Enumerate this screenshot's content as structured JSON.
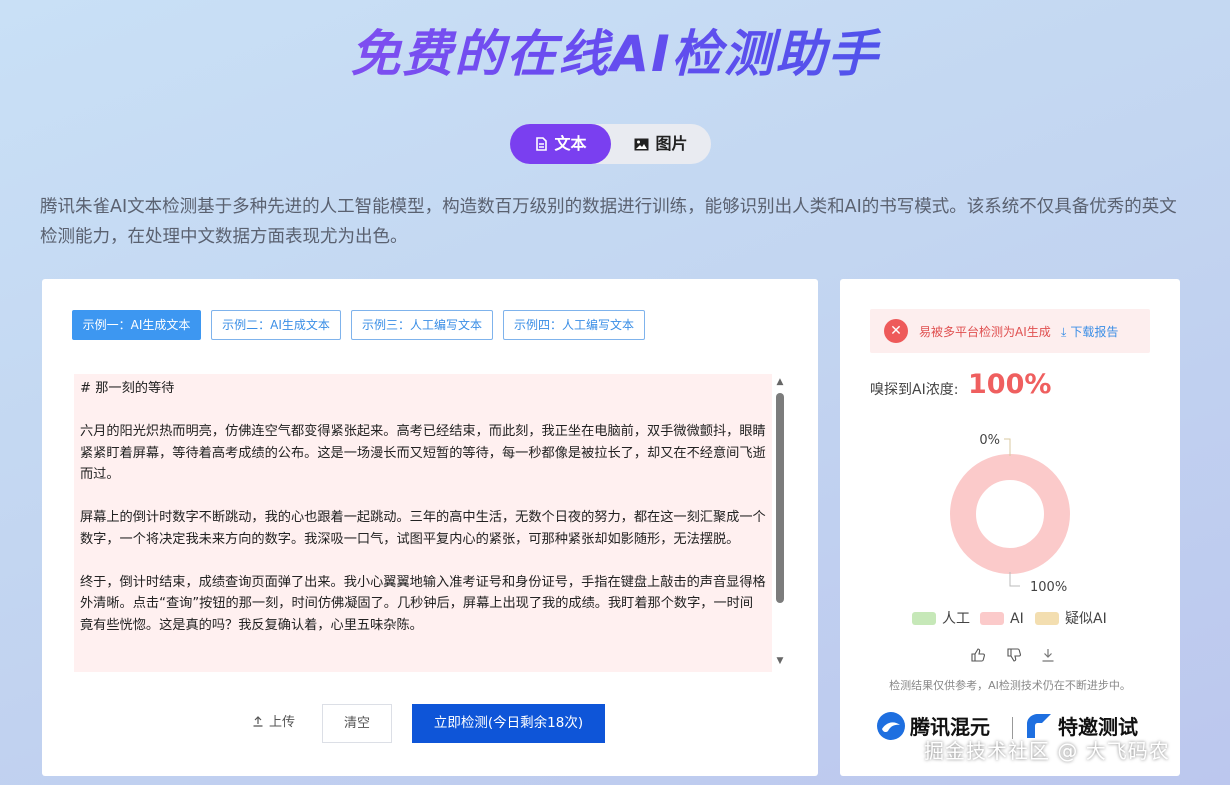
{
  "title": "免费的在线AI检测助手",
  "tabs": [
    {
      "label": "文本",
      "icon": "document-icon",
      "active": true
    },
    {
      "label": "图片",
      "icon": "image-icon",
      "active": false
    }
  ],
  "description": "腾讯朱雀AI文本检测基于多种先进的人工智能模型，构造数百万级别的数据进行训练，能够识别出人类和AI的书写模式。该系统不仅具备优秀的英文检测能力，在处理中文数据方面表现尤为出色。",
  "samples": [
    {
      "label": "示例一：AI生成文本",
      "active": true
    },
    {
      "label": "示例二：AI生成文本",
      "active": false
    },
    {
      "label": "示例三：人工编写文本",
      "active": false
    },
    {
      "label": "示例四：人工编写文本",
      "active": false
    }
  ],
  "editor": {
    "paragraphs": [
      "# 那一刻的等待",
      "六月的阳光炽热而明亮，仿佛连空气都变得紧张起来。高考已经结束，而此刻，我正坐在电脑前，双手微微颤抖，眼睛紧紧盯着屏幕，等待着高考成绩的公布。这是一场漫长而又短暂的等待，每一秒都像是被拉长了，却又在不经意间飞逝而过。",
      "屏幕上的倒计时数字不断跳动，我的心也跟着一起跳动。三年的高中生活，无数个日夜的努力，都在这一刻汇聚成一个数字，一个将决定我未来方向的数字。我深吸一口气，试图平复内心的紧张，可那种紧张却如影随形，无法摆脱。",
      "终于，倒计时结束，成绩查询页面弹了出来。我小心翼翼地输入准考证号和身份证号，手指在键盘上敲击的声音显得格外清晰。点击“查询”按钮的那一刻，时间仿佛凝固了。几秒钟后，屏幕上出现了我的成绩。我盯着那个数字，一时间竟有些恍惚。这是真的吗？我反复确认着，心里五味杂陈。"
    ]
  },
  "actions": {
    "upload": "上传",
    "clear": "清空",
    "detect": "立即检测(今日剩余18次)"
  },
  "result": {
    "warning": "易被多平台检测为AI生成",
    "download": "下载报告",
    "concentration_label": "嗅探到AI浓度:",
    "concentration_value": "100%",
    "disclaimer": "检测结果仅供参考，AI检测技术仍在不断进步中。",
    "brands": [
      "腾讯混元",
      "特邀测试"
    ]
  },
  "chart_data": {
    "type": "pie",
    "categories": [
      "人工",
      "AI",
      "疑似AI"
    ],
    "values": [
      0,
      100,
      0
    ],
    "colors": [
      "#c6e8b8",
      "#fbcaca",
      "#f3deb0"
    ],
    "data_labels": [
      "0%",
      "100%"
    ],
    "donut": true,
    "legend": "bottom"
  },
  "colors": {
    "accent": "#7a3ff0",
    "primary_button": "#0e55d8",
    "sample_active": "#3d97f1",
    "warning": "#ee5a5a",
    "percent": "#ef5f5f"
  },
  "watermark": "掘金技术社区 @ 大飞码农"
}
